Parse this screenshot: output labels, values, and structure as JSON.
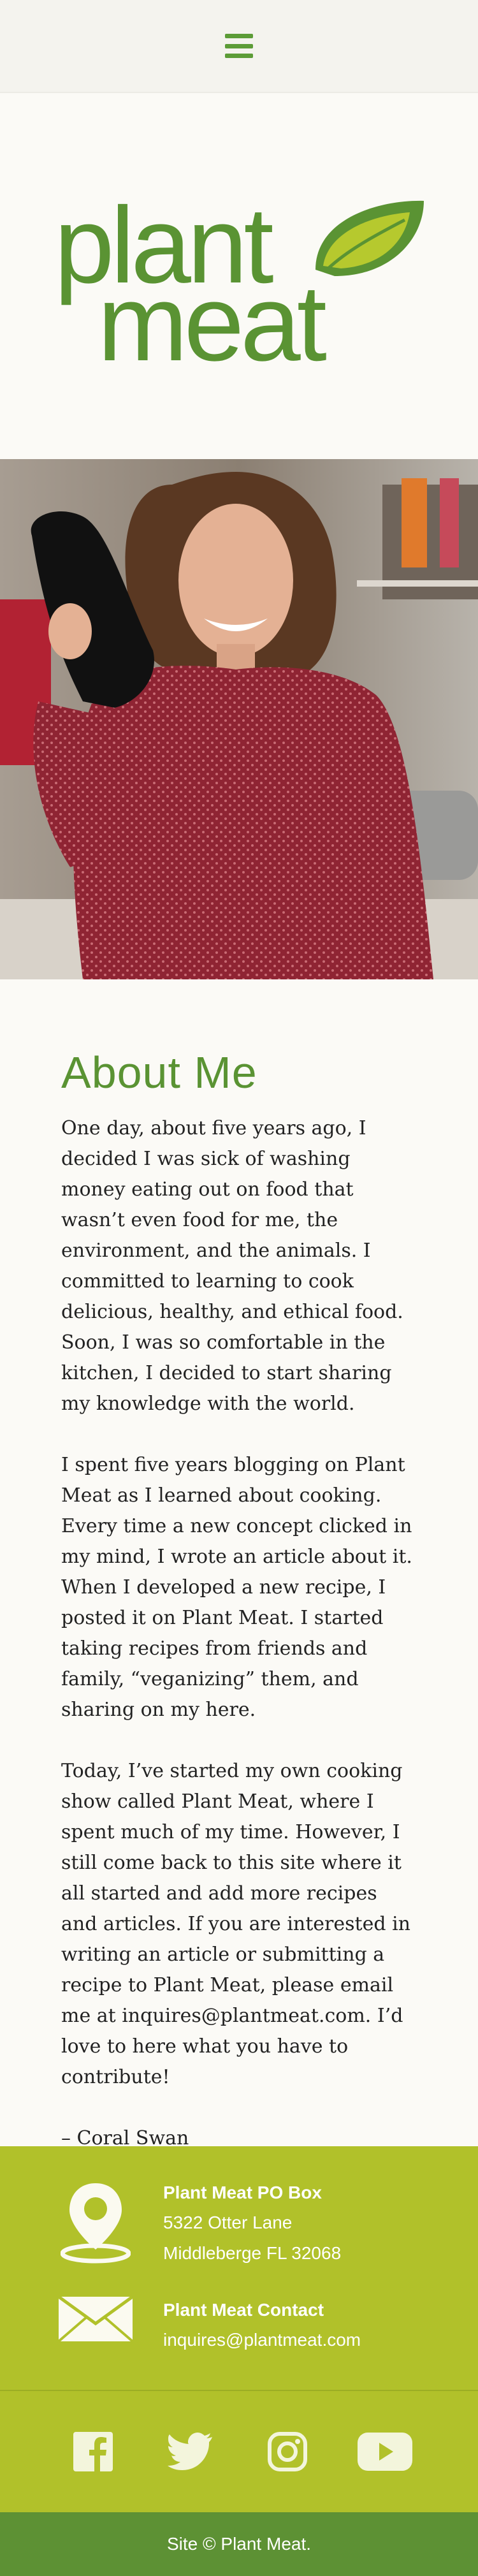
{
  "header": {
    "menu_icon": "hamburger-menu-icon"
  },
  "logo": {
    "line1": "plant",
    "line2": "meat",
    "leaf_icon": "leaf-icon"
  },
  "hero": {
    "alt": "woman-with-oven-mitt-photo"
  },
  "about": {
    "heading": "About Me",
    "paragraphs": [
      "One day, about five years ago, I decided I was sick of washing money eating out on food that wasn’t even food for me, the environment, and the animals. I committed to learning to cook delicious, healthy, and ethical food. Soon, I was so comfortable in the kitchen, I decided to start sharing my knowledge with the world.",
      "I spent five years blogging on Plant Meat as I learned about cooking. Every time a new concept clicked in my mind, I wrote an article about it. When I developed a new recipe, I posted it on Plant Meat. I started taking recipes from friends and family, “veganizing” them, and sharing on my here.",
      "Today, I’ve started my own cooking show called Plant Meat, where I spent much of my time. However, I still come back to this site where it all started and add more recipes and articles. If you are interested in writing an article or submitting a recipe to Plant Meat, please email me at inquires@plantmeat.com. I’d love to here what you have to contribute!"
    ],
    "signature": "– Coral Swan"
  },
  "contact": {
    "po_title": "Plant Meat PO Box",
    "po_line1": "5322 Otter Lane",
    "po_line2": "Middleberge FL 32068",
    "contact_title": "Plant Meat Contact",
    "contact_email": "inquires@plantmeat.com",
    "icons": [
      "map-pin-icon",
      "envelope-icon"
    ]
  },
  "social": [
    "facebook-icon",
    "twitter-icon",
    "instagram-icon",
    "youtube-icon"
  ],
  "footer": {
    "text": "Site © Plant Meat."
  },
  "colors": {
    "brand_green": "#5a9333",
    "lime": "#b1c12a",
    "footer_green": "#5d9134"
  }
}
